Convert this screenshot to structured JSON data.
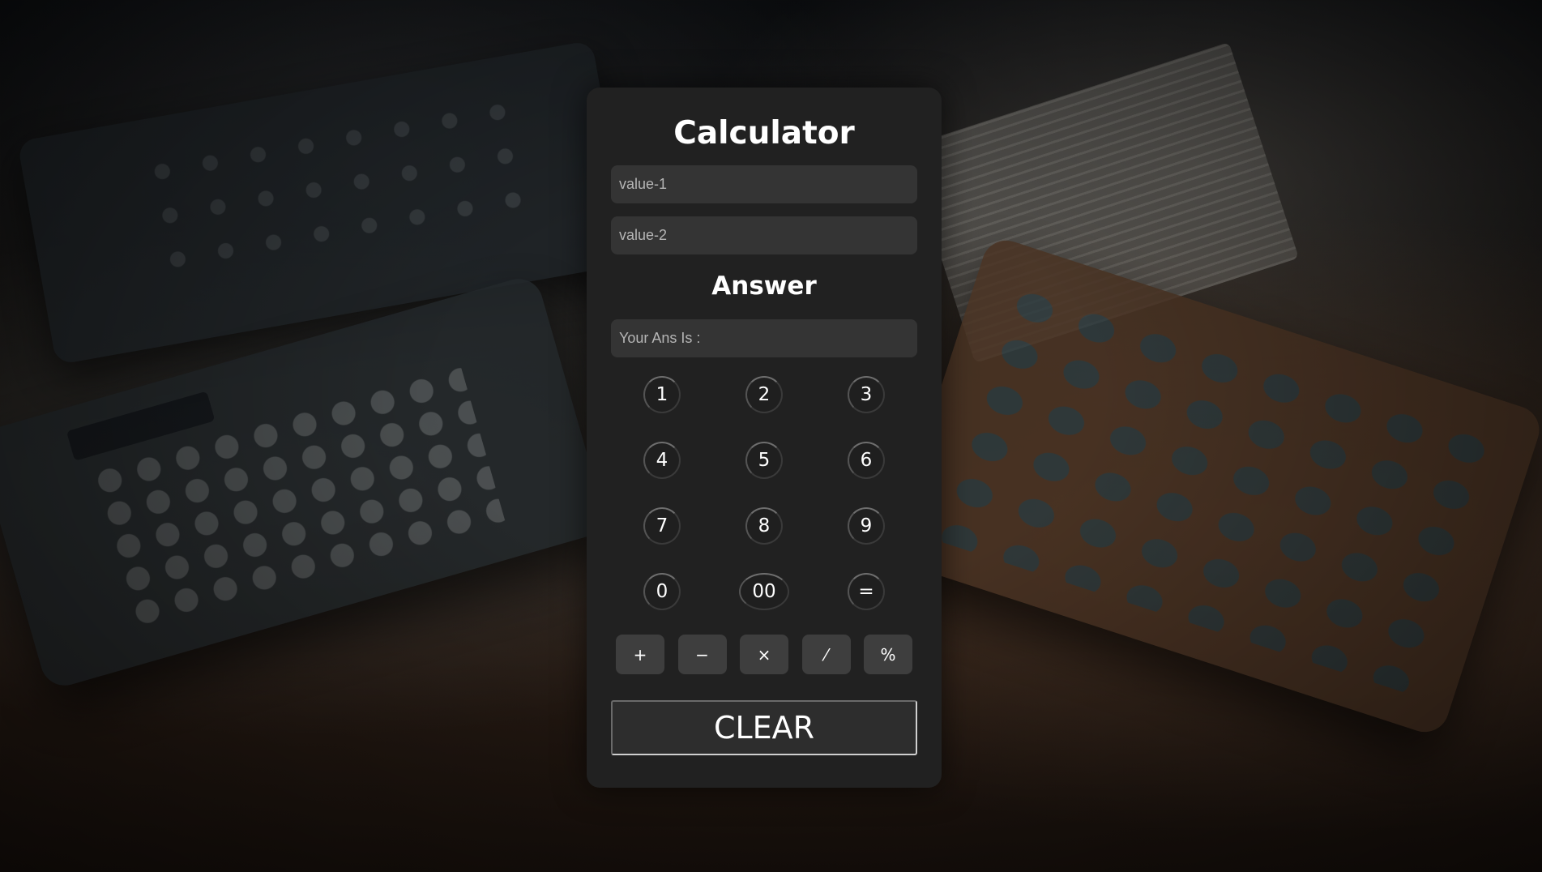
{
  "calculator": {
    "title": "Calculator",
    "value1_placeholder": "value-1",
    "value2_placeholder": "value-2",
    "answer_heading": "Answer",
    "answer_placeholder": "Your Ans Is :",
    "digits": [
      "1",
      "2",
      "3",
      "4",
      "5",
      "6",
      "7",
      "8",
      "9",
      "0",
      "00",
      "="
    ],
    "operators": [
      "+",
      "−",
      "×",
      "⁄",
      "%"
    ],
    "clear_label": "CLEAR"
  },
  "colors": {
    "card_background": "#212121",
    "input_background": "#343434",
    "operator_button": "#3e3e3e",
    "text": "#ffffff"
  },
  "background": {
    "description_icon": "calculators-desk-photo"
  }
}
